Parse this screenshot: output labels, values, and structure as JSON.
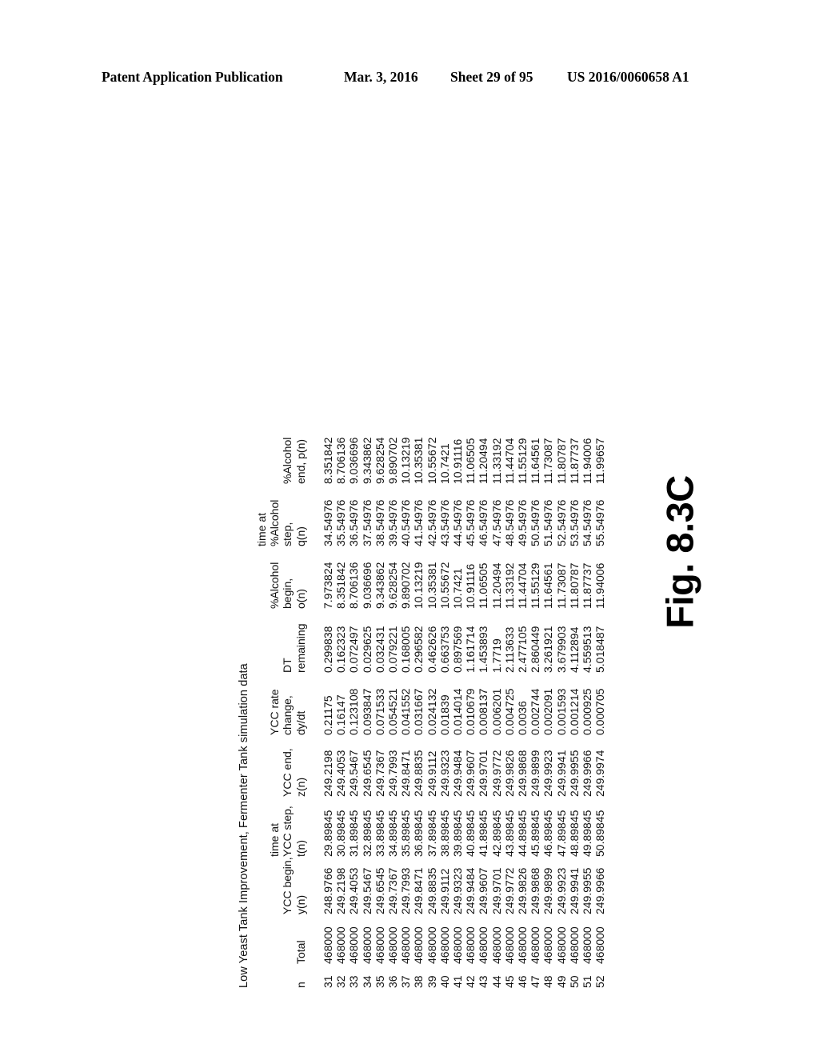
{
  "header": {
    "publication": "Patent Application Publication",
    "date": "Mar. 3, 2016",
    "sheet": "Sheet 29 of 95",
    "patent_number": "US 2016/0060658 A1"
  },
  "figure": {
    "caption": "Fig. 8.3C",
    "title": "Low Yeast Tank Improvement, Fermenter Tank simulation data",
    "rotation": "-90deg"
  },
  "table": {
    "columns": [
      {
        "key": "n",
        "lines": [
          "n"
        ]
      },
      {
        "key": "total",
        "lines": [
          "Total"
        ]
      },
      {
        "key": "ybeg",
        "lines": [
          "YCC begin,",
          "y(n)"
        ]
      },
      {
        "key": "tstep",
        "lines": [
          "time at",
          "YCC step,",
          "t(n)"
        ]
      },
      {
        "key": "yend",
        "lines": [
          "YCC end,",
          "z(n)"
        ]
      },
      {
        "key": "rate",
        "lines": [
          "YCC rate",
          "change,",
          "dy/dt"
        ]
      },
      {
        "key": "dt",
        "lines": [
          "DT",
          "remaining"
        ]
      },
      {
        "key": "abeg",
        "lines": [
          "%Alcohol",
          "begin,",
          "o(n)"
        ]
      },
      {
        "key": "astep",
        "lines": [
          "time at",
          "%Alcohol",
          "step,",
          "q(n)"
        ]
      },
      {
        "key": "aend",
        "lines": [
          "%Alcohol",
          "end, p(n)"
        ]
      }
    ],
    "rows": [
      [
        "31",
        "468000",
        "248.9766",
        "29.89845",
        "249.2198",
        "0.21175",
        "0.299838",
        "7.973824",
        "34.54976",
        "8.351842"
      ],
      [
        "32",
        "468000",
        "249.2198",
        "30.89845",
        "249.4053",
        "0.16147",
        "0.162323",
        "8.351842",
        "35.54976",
        "8.706136"
      ],
      [
        "33",
        "468000",
        "249.4053",
        "31.89845",
        "249.5467",
        "0.123108",
        "0.072497",
        "8.706136",
        "36.54976",
        "9.036696"
      ],
      [
        "34",
        "468000",
        "249.5467",
        "32.89845",
        "249.6545",
        "0.093847",
        "0.029625",
        "9.036696",
        "37.54976",
        "9.343862"
      ],
      [
        "35",
        "468000",
        "249.6545",
        "33.89845",
        "249.7367",
        "0.071533",
        "0.032431",
        "9.343862",
        "38.54976",
        "9.628254"
      ],
      [
        "36",
        "468000",
        "249.7367",
        "34.89845",
        "249.7993",
        "0.054521",
        "0.079221",
        "9.628254",
        "39.54976",
        "9.890702"
      ],
      [
        "37",
        "468000",
        "249.7993",
        "35.89845",
        "249.8471",
        "0.041552",
        "0.168005",
        "9.890702",
        "40.54976",
        "10.13219"
      ],
      [
        "38",
        "468000",
        "249.8471",
        "36.89845",
        "249.8835",
        "0.031667",
        "0.296582",
        "10.13219",
        "41.54976",
        "10.35381"
      ],
      [
        "39",
        "468000",
        "249.8835",
        "37.89845",
        "249.9112",
        "0.024132",
        "0.462626",
        "10.35381",
        "42.54976",
        "10.55672"
      ],
      [
        "40",
        "468000",
        "249.9112",
        "38.89845",
        "249.9323",
        "0.01839",
        "0.663753",
        "10.55672",
        "43.54976",
        "10.7421"
      ],
      [
        "41",
        "468000",
        "249.9323",
        "39.89845",
        "249.9484",
        "0.014014",
        "0.897569",
        "10.7421",
        "44.54976",
        "10.91116"
      ],
      [
        "42",
        "468000",
        "249.9484",
        "40.89845",
        "249.9607",
        "0.010679",
        "1.161714",
        "10.91116",
        "45.54976",
        "11.06505"
      ],
      [
        "43",
        "468000",
        "249.9607",
        "41.89845",
        "249.9701",
        "0.008137",
        "1.453893",
        "11.06505",
        "46.54976",
        "11.20494"
      ],
      [
        "44",
        "468000",
        "249.9701",
        "42.89845",
        "249.9772",
        "0.006201",
        "1.7719",
        "11.20494",
        "47.54976",
        "11.33192"
      ],
      [
        "45",
        "468000",
        "249.9772",
        "43.89845",
        "249.9826",
        "0.004725",
        "2.113633",
        "11.33192",
        "48.54976",
        "11.44704"
      ],
      [
        "46",
        "468000",
        "249.9826",
        "44.89845",
        "249.9868",
        "0.0036",
        "2.477105",
        "11.44704",
        "49.54976",
        "11.55129"
      ],
      [
        "47",
        "468000",
        "249.9868",
        "45.89845",
        "249.9899",
        "0.002744",
        "2.860449",
        "11.55129",
        "50.54976",
        "11.64561"
      ],
      [
        "48",
        "468000",
        "249.9899",
        "46.89845",
        "249.9923",
        "0.002091",
        "3.261921",
        "11.64561",
        "51.54976",
        "11.73087"
      ],
      [
        "49",
        "468000",
        "249.9923",
        "47.89845",
        "249.9941",
        "0.001593",
        "3.679903",
        "11.73087",
        "52.54976",
        "11.80787"
      ],
      [
        "50",
        "468000",
        "249.9941",
        "48.89845",
        "249.9955",
        "0.001214",
        "4.112894",
        "11.80787",
        "53.54976",
        "11.87737"
      ],
      [
        "51",
        "468000",
        "249.9955",
        "49.89845",
        "249.9966",
        "0.000925",
        "4.559513",
        "11.87737",
        "54.54976",
        "11.94006"
      ],
      [
        "52",
        "468000",
        "249.9966",
        "50.89845",
        "249.9974",
        "0.000705",
        "5.018487",
        "11.94006",
        "55.54976",
        "11.99657"
      ]
    ]
  }
}
